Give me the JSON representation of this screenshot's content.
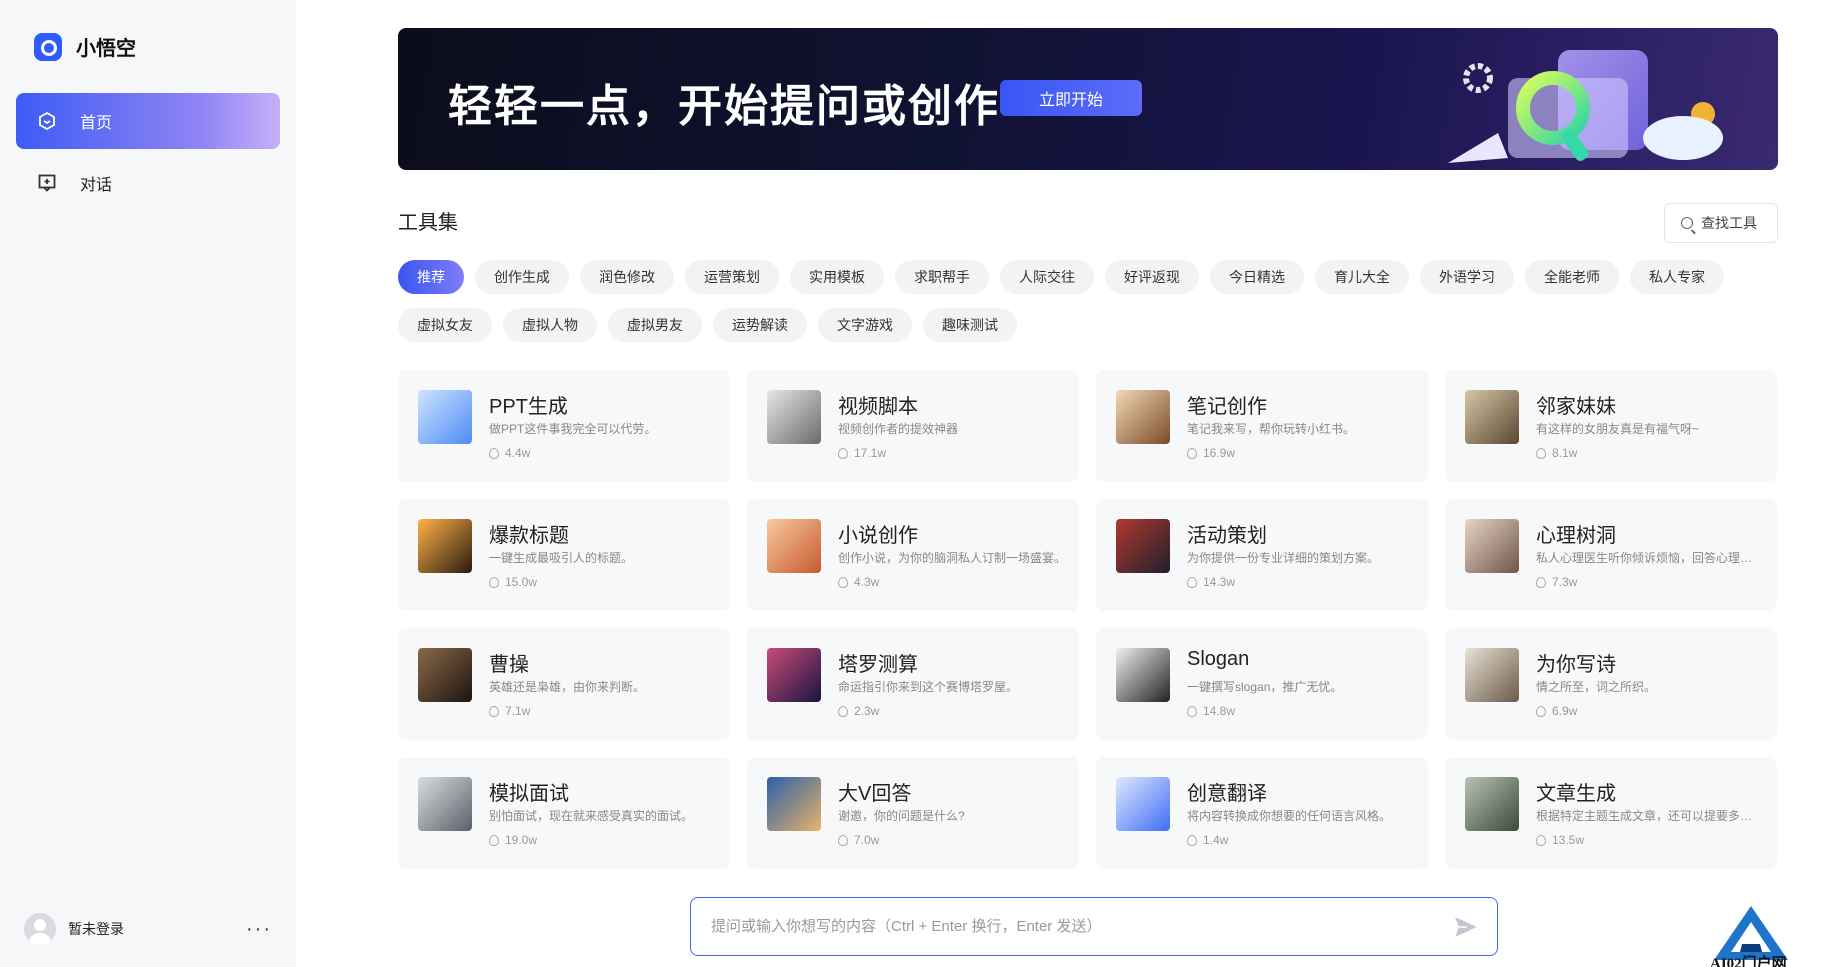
{
  "app": {
    "name": "小悟空"
  },
  "sidebar": {
    "items": [
      {
        "label": "首页",
        "icon": "home-icon",
        "active": true
      },
      {
        "label": "对话",
        "icon": "chat-icon",
        "active": false
      }
    ],
    "user": {
      "name": "暂未登录",
      "more": "···"
    }
  },
  "banner": {
    "title": "轻轻一点，开始提问或创作",
    "button": "立即开始"
  },
  "tools": {
    "title": "工具集",
    "search_label": "查找工具",
    "tags_row1": [
      "推荐",
      "创作生成",
      "润色修改",
      "运营策划",
      "实用模板",
      "求职帮手",
      "人际交往",
      "好评返现",
      "今日精选",
      "育儿大全",
      "外语学习",
      "全能老师",
      "私人专家"
    ],
    "tags_row2": [
      "虚拟女友",
      "虚拟人物",
      "虚拟男友",
      "运势解读",
      "文字游戏",
      "趣味测试"
    ],
    "active_tag": "推荐"
  },
  "cards": [
    {
      "title": "PPT生成",
      "desc": "做PPT这件事我完全可以代劳。",
      "count": "4.4w",
      "thumb": [
        "#cfe3ff",
        "#4d8cf5"
      ]
    },
    {
      "title": "视频脚本",
      "desc": "视频创作者的提效神器",
      "count": "17.1w",
      "thumb": [
        "#e6e6e6",
        "#6b6b6b"
      ]
    },
    {
      "title": "笔记创作",
      "desc": "笔记我来写，帮你玩转小红书。",
      "count": "16.9w",
      "thumb": [
        "#f1d9b5",
        "#7a4a2a"
      ]
    },
    {
      "title": "邻家妹妹",
      "desc": "有这样的女朋友真是有福气呀~",
      "count": "8.1w",
      "thumb": [
        "#d6c7a8",
        "#5b4630"
      ]
    },
    {
      "title": "爆款标题",
      "desc": "一键生成最吸引人的标题。",
      "count": "15.0w",
      "thumb": [
        "#ffb347",
        "#2a1a10"
      ]
    },
    {
      "title": "小说创作",
      "desc": "创作小说，为你的脑洞私人订制一场盛宴。",
      "count": "4.3w",
      "thumb": [
        "#f7c9a0",
        "#c85a2e"
      ]
    },
    {
      "title": "活动策划",
      "desc": "为你提供一份专业详细的策划方案。",
      "count": "14.3w",
      "thumb": [
        "#b03a2e",
        "#1f1f2e"
      ]
    },
    {
      "title": "心理树洞",
      "desc": "私人心理医生听你倾诉烦恼，回答心理问题。",
      "count": "7.3w",
      "thumb": [
        "#e8d5c4",
        "#6e5548"
      ]
    },
    {
      "title": "曹操",
      "desc": "英雄还是枭雄，由你来判断。",
      "count": "7.1w",
      "thumb": [
        "#8a6a4a",
        "#1d1410"
      ]
    },
    {
      "title": "塔罗测算",
      "desc": "命运指引你来到这个赛博塔罗屋。",
      "count": "2.3w",
      "thumb": [
        "#c94c7a",
        "#1b1440"
      ]
    },
    {
      "title": "Slogan",
      "desc": "一键撰写slogan，推广无忧。",
      "count": "14.8w",
      "thumb": [
        "#f0f0f0",
        "#222222"
      ]
    },
    {
      "title": "为你写诗",
      "desc": "情之所至，词之所织。",
      "count": "6.9w",
      "thumb": [
        "#e9e2d6",
        "#6a5a48"
      ]
    },
    {
      "title": "模拟面试",
      "desc": "别怕面试，现在就来感受真实的面试。",
      "count": "19.0w",
      "thumb": [
        "#d9dde0",
        "#5a6168"
      ]
    },
    {
      "title": "大V回答",
      "desc": "谢邀，你的问题是什么?",
      "count": "7.0w",
      "thumb": [
        "#2a5fa8",
        "#e8b36a"
      ]
    },
    {
      "title": "创意翻译",
      "desc": "将内容转换成你想要的任何语言风格。",
      "count": "1.4w",
      "thumb": [
        "#dfe8ff",
        "#3f6df5"
      ]
    },
    {
      "title": "文章生成",
      "desc": "根据特定主题生成文章，还可以提要多个需求。",
      "count": "13.5w",
      "thumb": [
        "#b9c2b2",
        "#3b4a3a"
      ]
    }
  ],
  "input": {
    "placeholder": "提问或输入你想写的内容（Ctrl + Enter 换行，Enter 发送）"
  },
  "watermark": {
    "text": "AI02门户网"
  }
}
